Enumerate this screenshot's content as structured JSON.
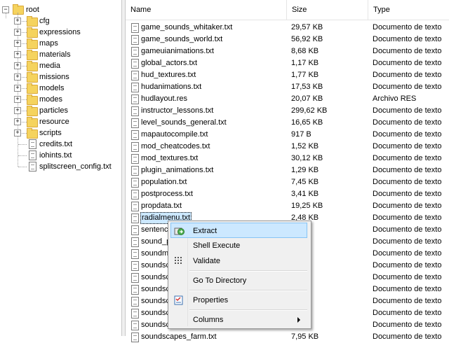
{
  "tree": {
    "root_label": "root",
    "folders": [
      "cfg",
      "expressions",
      "maps",
      "materials",
      "media",
      "missions",
      "models",
      "modes",
      "particles",
      "resource",
      "scripts"
    ],
    "files": [
      "credits.txt",
      "iohints.txt",
      "splitscreen_config.txt"
    ]
  },
  "list": {
    "columns": {
      "name": "Name",
      "size": "Size",
      "type": "Type"
    },
    "rows": [
      {
        "name": "game_sounds_whitaker.txt",
        "size": "29,57 KB",
        "type": "Documento de texto"
      },
      {
        "name": "game_sounds_world.txt",
        "size": "56,92 KB",
        "type": "Documento de texto"
      },
      {
        "name": "gameuianimations.txt",
        "size": "8,68 KB",
        "type": "Documento de texto"
      },
      {
        "name": "global_actors.txt",
        "size": "1,17 KB",
        "type": "Documento de texto"
      },
      {
        "name": "hud_textures.txt",
        "size": "1,77 KB",
        "type": "Documento de texto"
      },
      {
        "name": "hudanimations.txt",
        "size": "17,53 KB",
        "type": "Documento de texto"
      },
      {
        "name": "hudlayout.res",
        "size": "20,07 KB",
        "type": "Archivo RES"
      },
      {
        "name": "instructor_lessons.txt",
        "size": "299,62 KB",
        "type": "Documento de texto"
      },
      {
        "name": "level_sounds_general.txt",
        "size": "16,65 KB",
        "type": "Documento de texto"
      },
      {
        "name": "mapautocompile.txt",
        "size": "917 B",
        "type": "Documento de texto"
      },
      {
        "name": "mod_cheatcodes.txt",
        "size": "1,52 KB",
        "type": "Documento de texto"
      },
      {
        "name": "mod_textures.txt",
        "size": "30,12 KB",
        "type": "Documento de texto"
      },
      {
        "name": "plugin_animations.txt",
        "size": "1,29 KB",
        "type": "Documento de texto"
      },
      {
        "name": "population.txt",
        "size": "7,45 KB",
        "type": "Documento de texto"
      },
      {
        "name": "postprocess.txt",
        "size": "3,41 KB",
        "type": "Documento de texto"
      },
      {
        "name": "propdata.txt",
        "size": "19,25 KB",
        "type": "Documento de texto"
      },
      {
        "name": "radialmenu.txt",
        "size": "2,48 KB",
        "type": "Documento de texto"
      },
      {
        "name": "sentenc",
        "size": "",
        "type": "Documento de texto"
      },
      {
        "name": "sound_p",
        "size": "",
        "type": "Documento de texto"
      },
      {
        "name": "soundmi",
        "size": "KB",
        "type": "Documento de texto"
      },
      {
        "name": "soundsc",
        "size": "KB",
        "type": "Documento de texto"
      },
      {
        "name": "soundsc",
        "size": "KB",
        "type": "Documento de texto"
      },
      {
        "name": "soundsc",
        "size": "KB",
        "type": "Documento de texto"
      },
      {
        "name": "soundsc",
        "size": "KB",
        "type": "Documento de texto"
      },
      {
        "name": "soundsc",
        "size": "KB",
        "type": "Documento de texto"
      },
      {
        "name": "soundsc",
        "size": "KB",
        "type": "Documento de texto"
      },
      {
        "name": "soundscapes_farm.txt",
        "size": "7,95 KB",
        "type": "Documento de texto"
      }
    ]
  },
  "context_menu": {
    "items": [
      "Extract",
      "Shell Execute",
      "Validate",
      "Go To Directory",
      "Properties",
      "Columns"
    ]
  },
  "colors": {
    "selection": "#cce8ff",
    "menu_bg": "#f0f0f0",
    "folder": "#f5d35e"
  }
}
